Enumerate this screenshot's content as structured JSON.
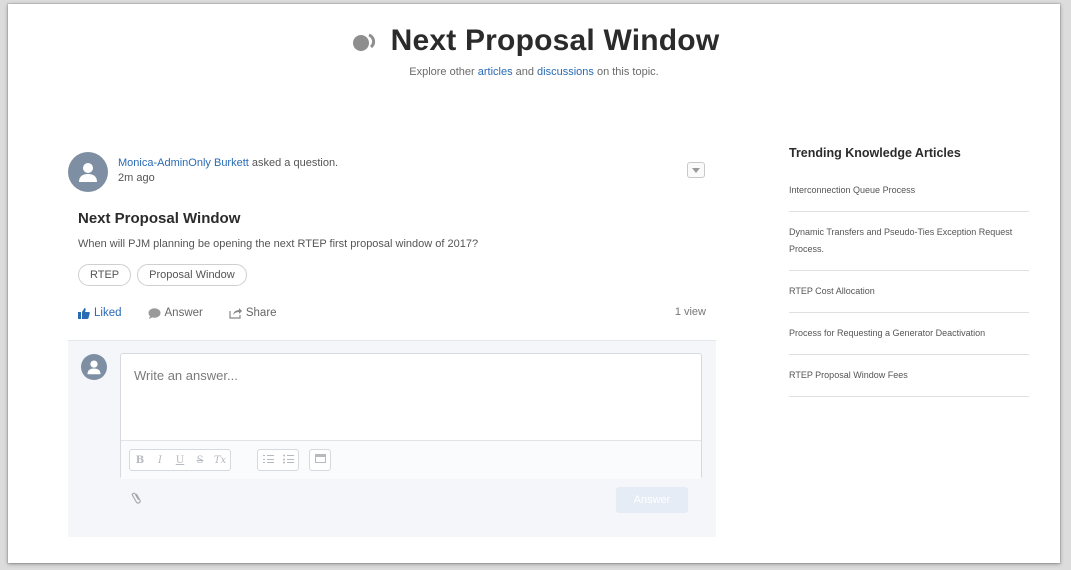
{
  "header": {
    "title": "Next Proposal Window",
    "subtitle_prefix": "Explore other ",
    "subtitle_link1": "articles",
    "subtitle_mid": " and ",
    "subtitle_link2": "discussions",
    "subtitle_suffix": " on this topic."
  },
  "question": {
    "author": "Monica-AdminOnly Burkett",
    "action_text": " asked a question.",
    "time_ago": "2m ago",
    "title": "Next Proposal Window",
    "body": "When will PJM planning be opening the next RTEP first proposal window of 2017?",
    "topics": [
      "RTEP",
      "Proposal Window"
    ],
    "actions": {
      "liked": "Liked",
      "answer": "Answer",
      "share": "Share"
    },
    "views": "1 view"
  },
  "answer_box": {
    "placeholder": "Write an answer...",
    "toolbar": [
      "B",
      "I",
      "U",
      "S",
      "Tx"
    ],
    "submit_label": "Answer"
  },
  "sidebar": {
    "title": "Trending Knowledge Articles",
    "articles": [
      "Interconnection Queue Process",
      "Dynamic Transfers and Pseudo-Ties Exception Request Process.",
      "RTEP Cost Allocation",
      "Process for Requesting a Generator Deactivation",
      "RTEP Proposal Window Fees"
    ]
  },
  "colors": {
    "link": "#2a6bb3",
    "avatar": "#7f8fa3",
    "answer_panel": "#f4f6f9"
  }
}
